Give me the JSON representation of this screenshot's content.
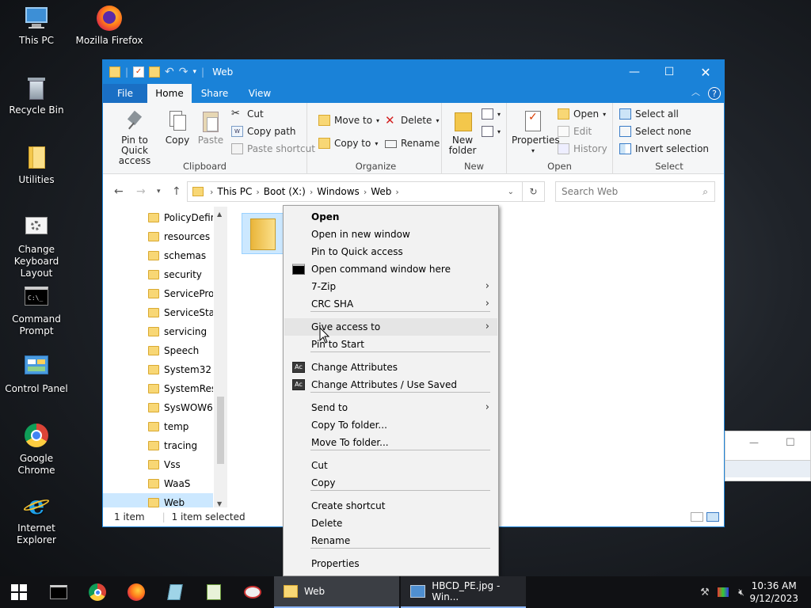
{
  "desktop": {
    "icons": [
      {
        "label": "This PC",
        "icon": "this-pc-icon"
      },
      {
        "label": "Mozilla Firefox",
        "icon": "firefox-icon"
      },
      {
        "label": "Recycle Bin",
        "icon": "recycle-bin-icon"
      },
      {
        "label": "Utilities",
        "icon": "folder-icon"
      },
      {
        "label": "Change Keyboard Layout",
        "icon": "keyboard-settings-icon"
      },
      {
        "label": "Command Prompt",
        "icon": "cmd-icon"
      },
      {
        "label": "Control Panel",
        "icon": "control-panel-icon"
      },
      {
        "label": "Google Chrome",
        "icon": "chrome-icon"
      },
      {
        "label": "Internet Explorer",
        "icon": "ie-icon"
      }
    ]
  },
  "window": {
    "title": "Web",
    "tabs": [
      "File",
      "Home",
      "Share",
      "View"
    ],
    "ribbon": {
      "clipboard": {
        "label": "Clipboard",
        "pin": "Pin to Quick access",
        "copy": "Copy",
        "paste": "Paste",
        "cut": "Cut",
        "copy_path": "Copy path",
        "paste_shortcut": "Paste shortcut"
      },
      "organize": {
        "label": "Organize",
        "move_to": "Move to",
        "copy_to": "Copy to",
        "delete": "Delete",
        "rename": "Rename"
      },
      "new": {
        "label": "New",
        "new_folder": "New folder"
      },
      "open": {
        "label": "Open",
        "properties": "Properties",
        "open": "Open",
        "edit": "Edit",
        "history": "History"
      },
      "select": {
        "label": "Select",
        "select_all": "Select all",
        "select_none": "Select none",
        "invert": "Invert selection"
      }
    },
    "address": {
      "crumbs": [
        "This PC",
        "Boot (X:)",
        "Windows",
        "Web"
      ],
      "search_placeholder": "Search Web"
    },
    "nav_items": [
      "PolicyDefinitions",
      "resources",
      "schemas",
      "security",
      "ServiceProfiles",
      "ServiceState",
      "servicing",
      "Speech",
      "System32",
      "SystemResources",
      "SysWOW64",
      "temp",
      "tracing",
      "Vss",
      "WaaS",
      "Web"
    ],
    "status": {
      "count": "1 item",
      "selected": "1 item selected"
    }
  },
  "context_menu": {
    "items": [
      {
        "label": "Open",
        "bold": true
      },
      {
        "label": "Open in new window"
      },
      {
        "label": "Pin to Quick access"
      },
      {
        "label": "Open command window here",
        "icon": "cmd-icon"
      },
      {
        "label": "7-Zip",
        "submenu": true
      },
      {
        "label": "CRC SHA",
        "submenu": true
      },
      {
        "label": "Give access to",
        "submenu": true
      },
      {
        "label": "Pin to Start"
      },
      {
        "label": "Change Attributes",
        "icon": "attributes-icon"
      },
      {
        "label": "Change Attributes / Use Saved",
        "icon": "attributes-icon"
      },
      {
        "label": "Send to",
        "submenu": true
      },
      {
        "label": "Copy To folder..."
      },
      {
        "label": "Move To folder..."
      },
      {
        "label": "Cut"
      },
      {
        "label": "Copy"
      },
      {
        "label": "Create shortcut"
      },
      {
        "label": "Delete"
      },
      {
        "label": "Rename"
      },
      {
        "label": "Properties"
      }
    ]
  },
  "taskbar": {
    "windows": [
      {
        "label": "Web",
        "active": true
      },
      {
        "label": "HBCD_PE.jpg - Win..."
      }
    ],
    "time": "10:36 AM",
    "date": "9/12/2023"
  },
  "colors": {
    "accent": "#1a82d8",
    "folder": "#f8d775",
    "selection": "#cce8ff"
  }
}
